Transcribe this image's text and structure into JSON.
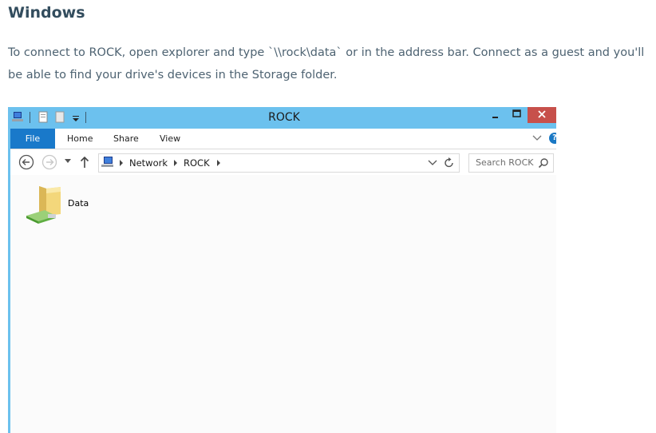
{
  "article": {
    "heading": "Windows",
    "paragraph": "To connect to ROCK, open explorer and type `\\\\rock\\data` or in the address bar. Connect as a guest and you'll be able to find your drive's devices in the Storage folder."
  },
  "window": {
    "title": "ROCK",
    "ribbon_tabs": {
      "file": "File",
      "home": "Home",
      "share": "Share",
      "view": "View"
    },
    "help_glyph": "?",
    "breadcrumb": [
      "Network",
      "ROCK"
    ],
    "search_placeholder": "Search ROCK",
    "items": [
      {
        "label": "Data",
        "icon": "shared-folder-icon"
      }
    ]
  },
  "colors": {
    "titlebar": "#6cc1ee",
    "file_tab": "#1979ca",
    "close_button": "#c7504b",
    "heading": "#334d5e",
    "body_text": "#4e6372"
  }
}
